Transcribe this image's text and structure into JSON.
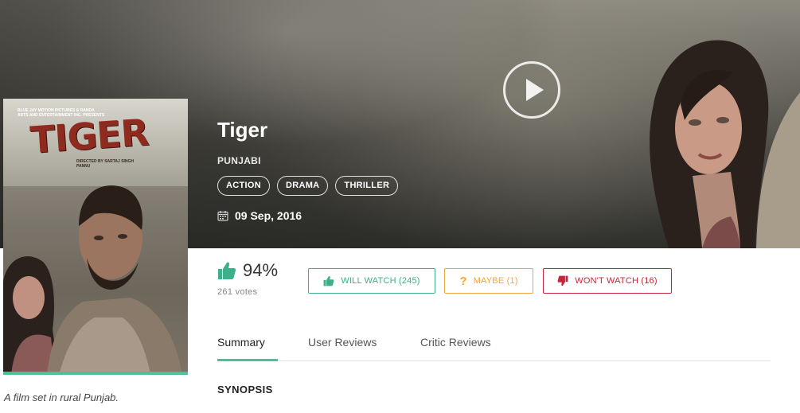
{
  "movie": {
    "title": "Tiger",
    "language": "PUNJABI",
    "genres": [
      "ACTION",
      "DRAMA",
      "THRILLER"
    ],
    "release_date": "09 Sep, 2016",
    "logline": "A film set in rural Punjab."
  },
  "poster": {
    "tagline": "BLUE JAY MOTION PICTURES & RANDA ARTS AND ENTERTAINMENT INC. PRESENTS",
    "title": "TIGER",
    "credit": "DIRECTED BY SARTAJ SINGH PANNU"
  },
  "rating": {
    "percent": "94%",
    "votes": "261 votes"
  },
  "actions": {
    "will_watch": "WILL WATCH (245)",
    "maybe": "MAYBE (1)",
    "wont_watch": "WON'T WATCH (16)"
  },
  "tabs": {
    "summary": "Summary",
    "user_reviews": "User Reviews",
    "critic_reviews": "Critic Reviews"
  },
  "synopsis": {
    "heading": "SYNOPSIS"
  },
  "colors": {
    "accent_green": "#4fbf97",
    "will_green": "#3fae8a",
    "maybe_orange": "#f2a53a",
    "wont_red": "#c4273a"
  },
  "icons": [
    "play-icon",
    "calendar-icon",
    "thumbs-up-icon",
    "question-icon",
    "thumbs-down-icon"
  ]
}
